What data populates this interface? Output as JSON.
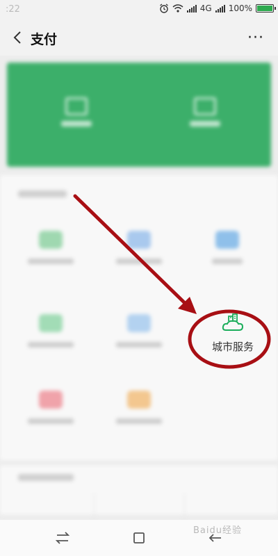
{
  "status_bar": {
    "time": ":22",
    "network": "4G",
    "battery": "100%"
  },
  "header": {
    "title": "支付",
    "more_label": "···"
  },
  "highlighted_service": {
    "label": "城市服务",
    "icon": "city-building-cloud-icon",
    "accent_color": "#1aad5a"
  },
  "annotation": {
    "arrow_color": "#a80f14",
    "circle_color": "#a80f14"
  },
  "watermark": {
    "text": "Baidu经验"
  },
  "navbar": {
    "buttons": [
      "switch-apps-icon",
      "home-square-icon",
      "back-arrow-icon"
    ]
  }
}
